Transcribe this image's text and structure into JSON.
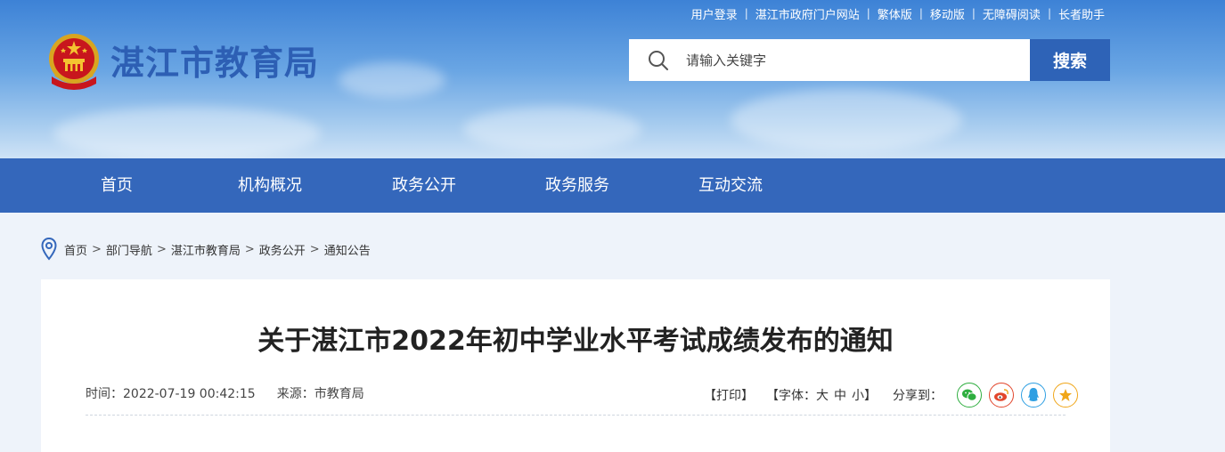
{
  "header": {
    "top_links": [
      "用户登录",
      "湛江市政府门户网站",
      "繁体版",
      "移动版",
      "无障碍阅读",
      "长者助手"
    ],
    "site_title": "湛江市教育局",
    "search": {
      "placeholder": "请输入关键字",
      "value": "",
      "button_label": "搜索"
    }
  },
  "nav": {
    "items": [
      "首页",
      "机构概况",
      "政务公开",
      "政务服务",
      "互动交流"
    ]
  },
  "breadcrumb": {
    "items": [
      "首页",
      "部门导航",
      "湛江市教育局",
      "政务公开",
      "通知公告"
    ],
    "separator": ">"
  },
  "article": {
    "title": "关于湛江市2022年初中学业水平考试成绩发布的通知",
    "time": "时间：2022-07-19 00:42:15",
    "source": "来源：市教育局",
    "print_label": "【打印】",
    "font_prefix": "【字体：",
    "font_large": "大",
    "font_medium": "中",
    "font_small": "小",
    "font_suffix": "】",
    "share_label": "分享到："
  },
  "share": [
    {
      "name": "wechat-icon",
      "color": "#2eae3f"
    },
    {
      "name": "weibo-icon",
      "color": "#e2462c"
    },
    {
      "name": "qq-icon",
      "color": "#2e9fe2"
    },
    {
      "name": "qzone-icon",
      "color": "#f0a619"
    }
  ],
  "colors": {
    "nav_bg": "#3467bb",
    "search_button": "#2e63b7",
    "title_blue": "#2d5fb4",
    "page_bg": "#eef3fa"
  }
}
